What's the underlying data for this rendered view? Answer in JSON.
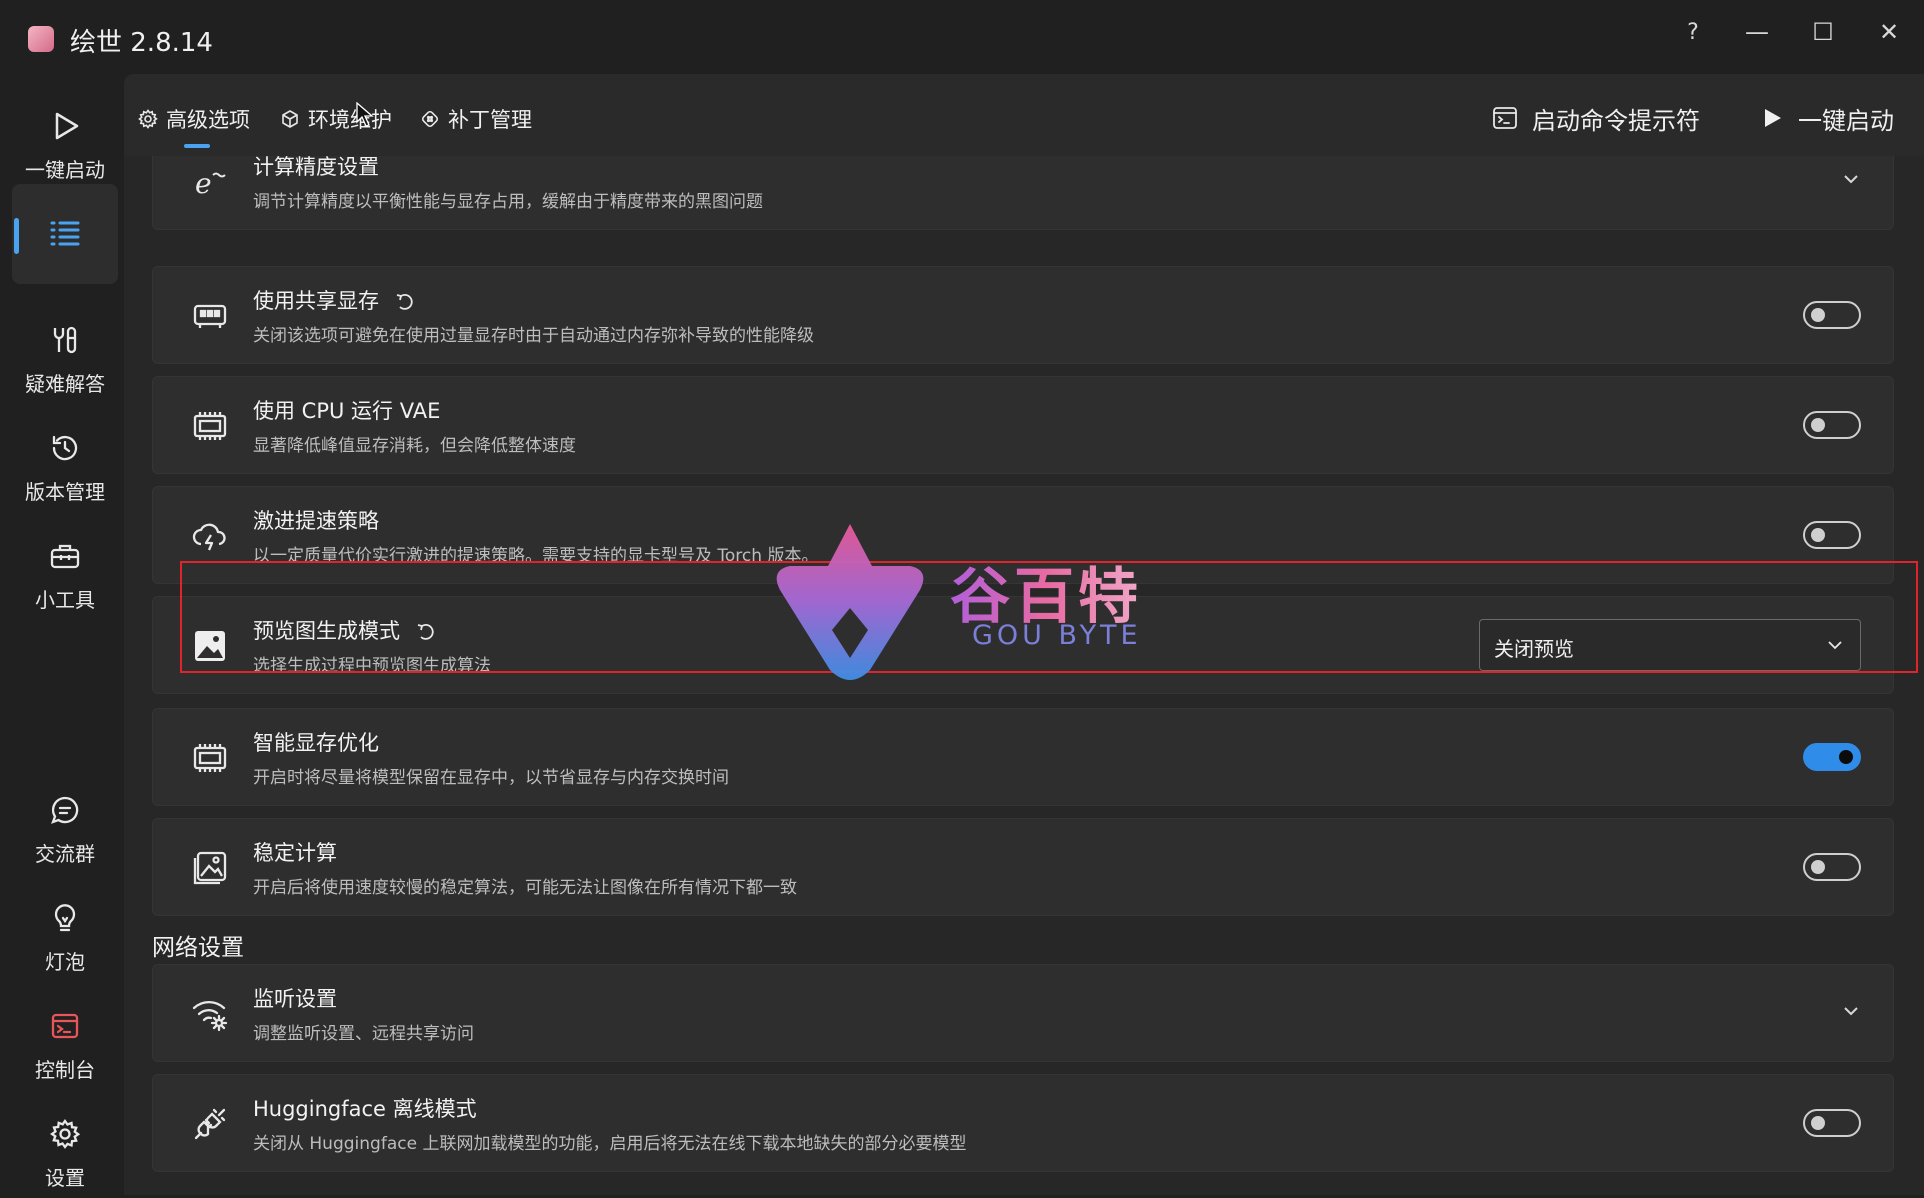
{
  "window": {
    "title": "绘世 2.8.14",
    "help": "?",
    "minimize": "—",
    "maximize": "☐",
    "close": "✕"
  },
  "sidebar": {
    "items": [
      {
        "label": "一键启动",
        "icon": "play-icon"
      },
      {
        "label": "",
        "icon": "list-icon",
        "active": true
      },
      {
        "label": "疑难解答",
        "icon": "wrench-icon"
      },
      {
        "label": "版本管理",
        "icon": "history-icon"
      },
      {
        "label": "小工具",
        "icon": "toolbox-icon"
      },
      {
        "label": "交流群",
        "icon": "chat-icon"
      },
      {
        "label": "灯泡",
        "icon": "bulb-icon"
      },
      {
        "label": "控制台",
        "icon": "console-icon"
      },
      {
        "label": "设置",
        "icon": "gear-icon"
      }
    ]
  },
  "topbar": {
    "tabs": [
      {
        "label": "高级选项",
        "icon": "gear-icon",
        "active": true
      },
      {
        "label": "环境维护",
        "icon": "cube-icon"
      },
      {
        "label": "补丁管理",
        "icon": "patch-icon"
      }
    ],
    "cmd_label": "启动命令提示符",
    "launch_label": "一键启动"
  },
  "settings": [
    {
      "title": "计算精度设置",
      "desc": "调节计算精度以平衡性能与显存占用，缓解由于精度带来的黑图问题",
      "control": "expand",
      "icon": "precision-icon"
    },
    {
      "title": "使用共享显存",
      "desc": "关闭该选项可避免在使用过量显存时由于自动通过内存弥补导致的性能降级",
      "control": "toggle",
      "on": false,
      "reset": true,
      "icon": "gpu-memory-icon"
    },
    {
      "title": "使用 CPU 运行 VAE",
      "desc": "显著降低峰值显存消耗，但会降低整体速度",
      "control": "toggle",
      "on": false,
      "icon": "cpu-icon"
    },
    {
      "title": "激进提速策略",
      "desc": "以一定质量代价实行激进的提速策略。需要支持的显卡型号及 Torch 版本。",
      "control": "toggle",
      "on": false,
      "icon": "cloud-speed-icon"
    },
    {
      "title": "预览图生成模式",
      "desc": "选择生成过程中预览图生成算法",
      "control": "select",
      "value": "关闭预览",
      "reset": true,
      "icon": "image-icon"
    },
    {
      "title": "智能显存优化",
      "desc": "开启时将尽量将模型保留在显存中，以节省显存与内存交换时间",
      "control": "toggle",
      "on": true,
      "icon": "chip-icon"
    },
    {
      "title": "稳定计算",
      "desc": "开启后将使用速度较慢的稳定算法，可能无法让图像在所有情况下都一致",
      "control": "toggle",
      "on": false,
      "icon": "stable-image-icon"
    }
  ],
  "network": {
    "section_title": "网络设置",
    "items": [
      {
        "title": "监听设置",
        "desc": "调整监听设置、远程共享访问",
        "control": "expand",
        "icon": "wifi-gear-icon"
      },
      {
        "title": "Huggingface 离线模式",
        "desc": "关闭从 Huggingface 上联网加载模型的功能，启用后将无法在线下载本地缺失的部分必要模型",
        "control": "toggle",
        "on": false,
        "icon": "plug-icon"
      }
    ]
  },
  "watermark": {
    "main": "谷百特",
    "sub": "GOU BYTE"
  },
  "colors": {
    "accent": "#2f8ce8",
    "highlight": "#e0242c",
    "bg": "#202020",
    "card": "#2e2e2e"
  }
}
